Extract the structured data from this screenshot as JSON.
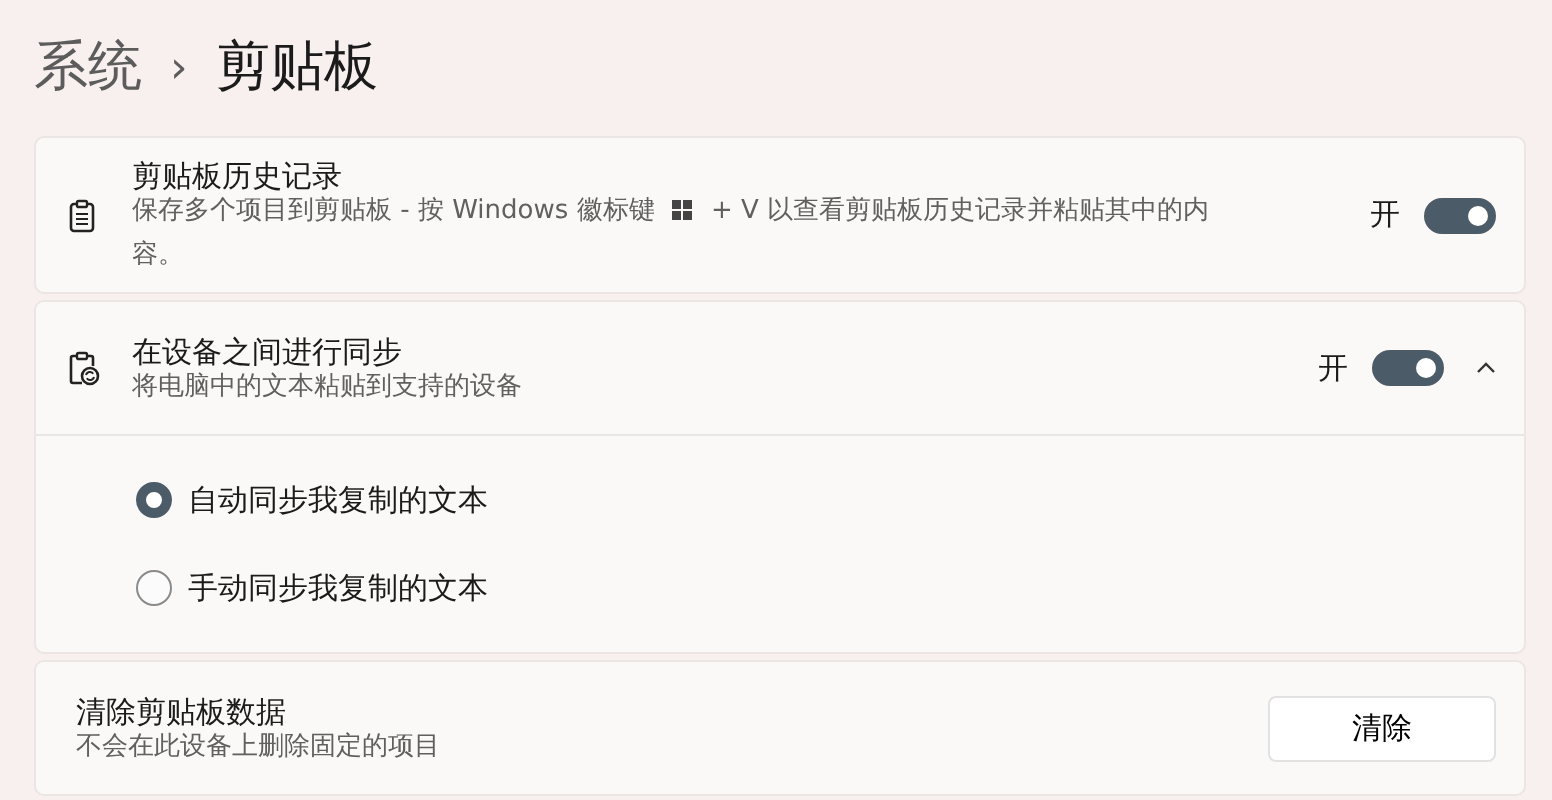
{
  "breadcrumb": {
    "parent": "系统",
    "separator": "›",
    "current": "剪贴板"
  },
  "settings": [
    {
      "kind": "toggle",
      "title": "剪贴板历史记录",
      "description_before_key": "保存多个项目到剪贴板 - 按 Windows 徽标键",
      "description_after_key": "+ V 以查看剪贴板历史记录并粘贴其中的内",
      "description_wrapped": "容。",
      "state_label": "开",
      "on": true
    },
    {
      "kind": "toggle",
      "title": "在设备之间进行同步",
      "description": "将电脑中的文本粘贴到支持的设备",
      "state_label": "开",
      "on": true,
      "expanded": true,
      "options": [
        {
          "label": "自动同步我复制的文本",
          "selected": true
        },
        {
          "label": "手动同步我复制的文本",
          "selected": false
        }
      ]
    },
    {
      "kind": "button",
      "title": "清除剪贴板数据",
      "description": "不会在此设备上删除固定的项目",
      "button": "清除"
    }
  ]
}
